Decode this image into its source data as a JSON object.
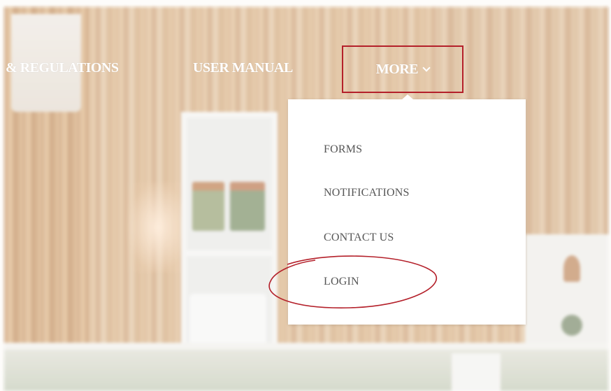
{
  "nav": {
    "items": [
      {
        "label": "& REGULATIONS"
      },
      {
        "label": "USER MANUAL"
      },
      {
        "label": "MORE",
        "icon": "chevron-down-icon"
      }
    ]
  },
  "dropdown": {
    "items": [
      {
        "label": "FORMS"
      },
      {
        "label": "NOTIFICATIONS"
      },
      {
        "label": "CONTACT US"
      },
      {
        "label": "LOGIN"
      }
    ]
  },
  "colors": {
    "highlight": "#b4202a",
    "menu_text": "#555555",
    "nav_text": "#ffffff"
  }
}
